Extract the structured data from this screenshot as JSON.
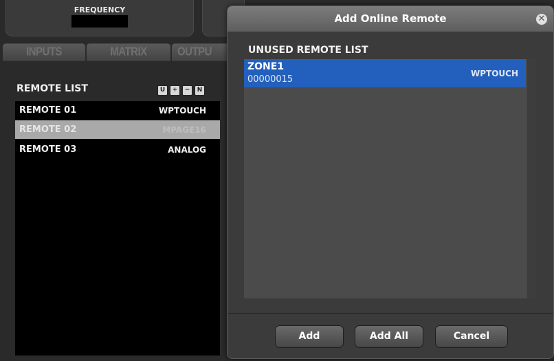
{
  "frequency_panel": {
    "label": "FREQUENCY"
  },
  "tabs": [
    {
      "label": "INPUTS"
    },
    {
      "label": "MATRIX"
    },
    {
      "label": "OUTPU"
    }
  ],
  "remote_list": {
    "title": "REMOTE LIST",
    "toolbar": {
      "u_label": "U",
      "plus_label": "+",
      "minus_label": "−",
      "n_label": "N"
    },
    "rows": [
      {
        "name": "REMOTE 01",
        "type": "WPTOUCH",
        "selected": false
      },
      {
        "name": "REMOTE 02",
        "type": "MPAGE16",
        "selected": true
      },
      {
        "name": "REMOTE 03",
        "type": "ANALOG",
        "selected": false
      }
    ]
  },
  "dialog": {
    "title": "Add Online Remote",
    "close_icon": "close-icon",
    "list_title": "UNUSED REMOTE LIST",
    "items": [
      {
        "name": "ZONE1",
        "id": "00000015",
        "type": "WPTOUCH",
        "selected": true
      }
    ],
    "buttons": {
      "add": "Add",
      "add_all": "Add All",
      "cancel": "Cancel"
    }
  },
  "colors": {
    "selection_blue": "#2360bd",
    "selection_gray": "#a9a9a9",
    "background": "#2a2a2a"
  }
}
